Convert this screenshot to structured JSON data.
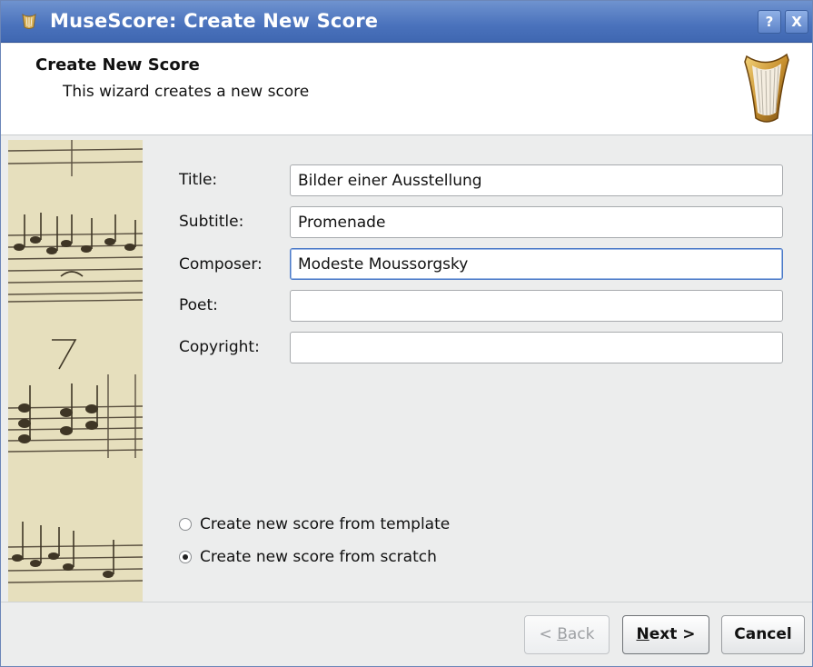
{
  "window": {
    "title": "MuseScore: Create New Score",
    "help_label": "?",
    "close_label": "X"
  },
  "header": {
    "title": "Create New Score",
    "subtitle": "This wizard creates a new score"
  },
  "form": {
    "title": {
      "label": "Title:",
      "value": "Bilder einer Ausstellung"
    },
    "subtitle": {
      "label": "Subtitle:",
      "value": "Promenade"
    },
    "composer": {
      "label": "Composer:",
      "value": "Modeste Moussorgsky"
    },
    "poet": {
      "label": "Poet:",
      "value": ""
    },
    "copyright": {
      "label": "Copyright:",
      "value": ""
    }
  },
  "options": {
    "template_label": "Create new score from template",
    "scratch_label": "Create new score from scratch",
    "selected": "scratch"
  },
  "buttons": {
    "back_prefix": "< ",
    "back_mnemonic": "B",
    "back_rest": "ack",
    "next_mnemonic": "N",
    "next_rest": "ext >",
    "cancel": "Cancel"
  },
  "icons": {
    "app": "harp-icon",
    "logo": "harp-logo",
    "side": "sheet-music-image"
  },
  "colors": {
    "titlebar": "#4a72bc",
    "focus": "#4a79c8",
    "parchment": "#e6dfbd"
  }
}
